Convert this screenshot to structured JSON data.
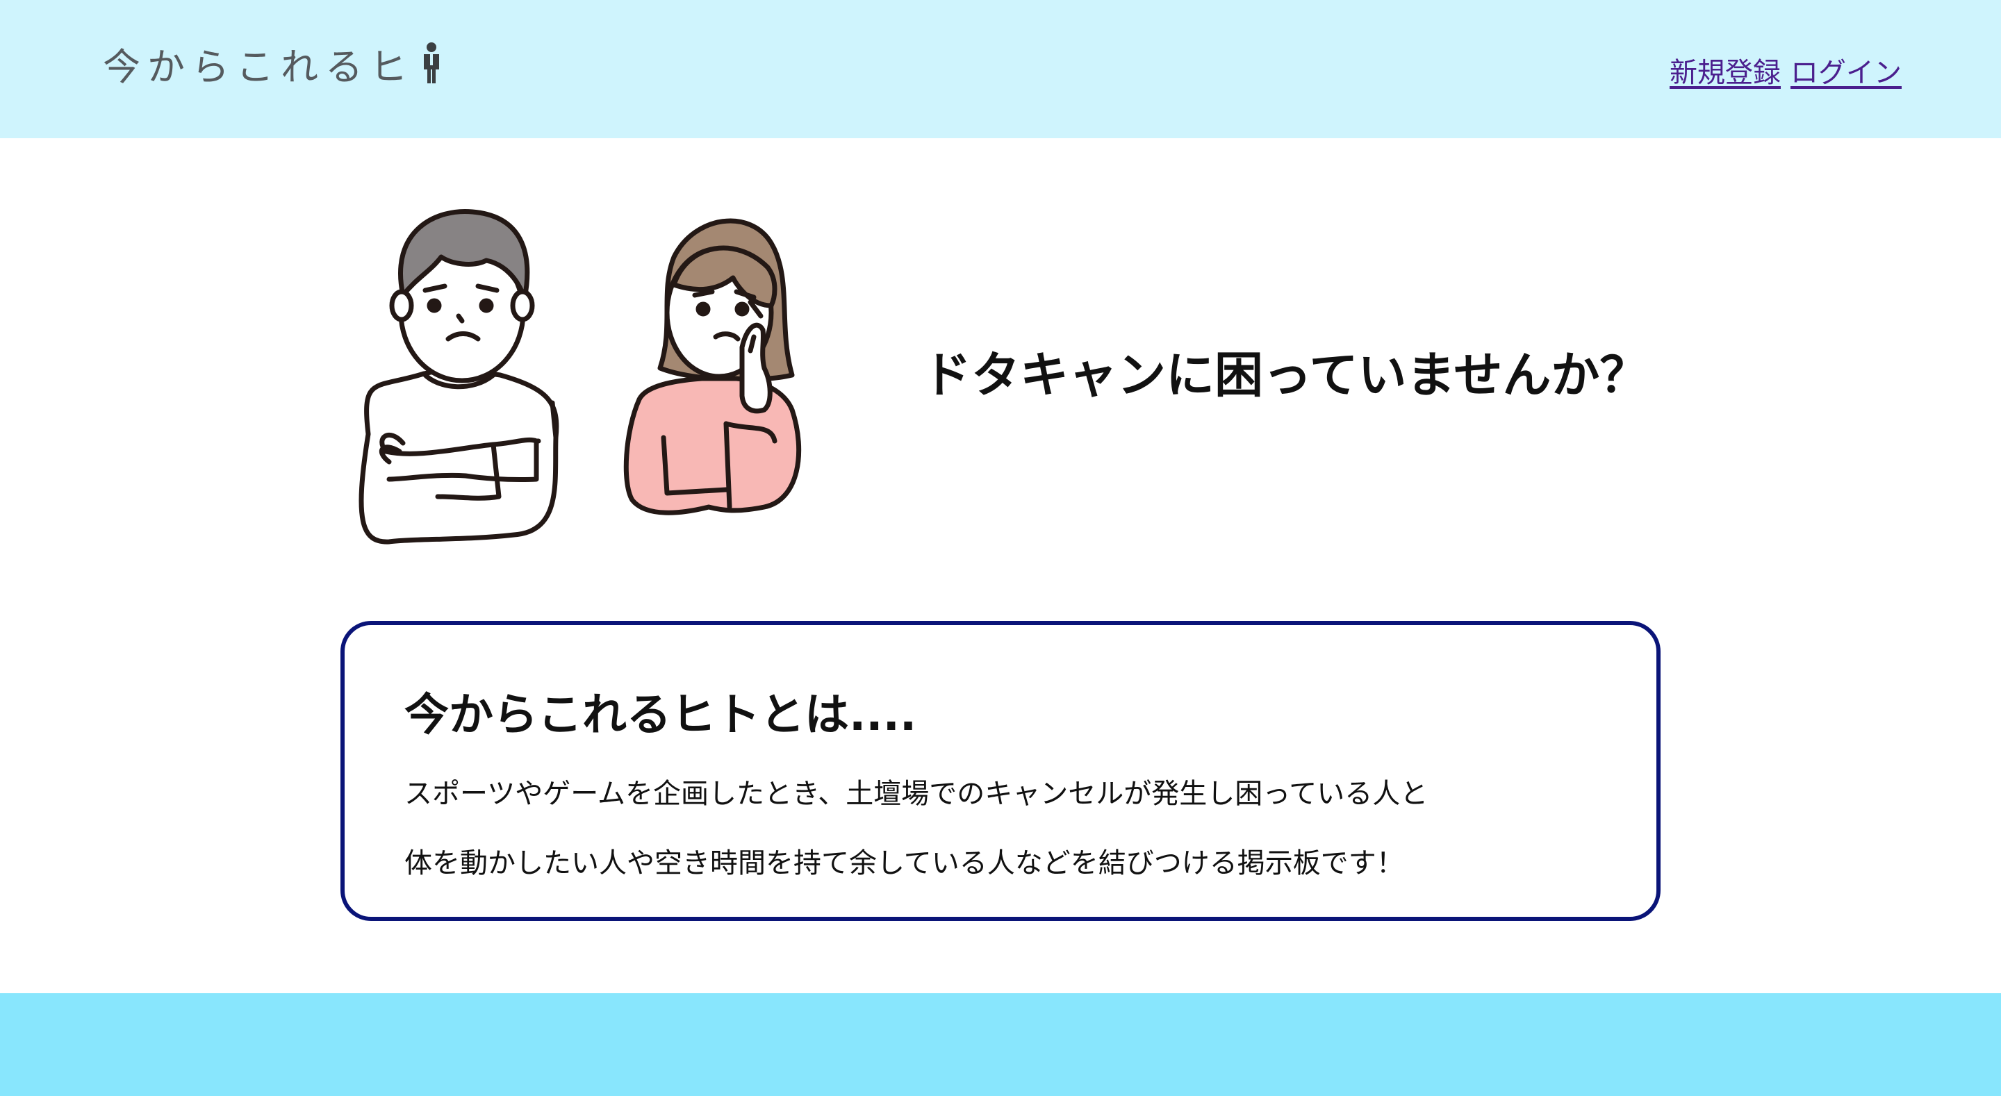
{
  "header": {
    "logo_text": "今からこれるヒ",
    "logo_icon": "person-icon",
    "nav": {
      "signup_label": "新規登録",
      "login_label": "ログイン"
    }
  },
  "hero": {
    "illustration": "two-worried-people",
    "question": "ドタキャンに困っていませんか？"
  },
  "about": {
    "title": "今からこれるヒトとは....",
    "lines": [
      "スポーツやゲームを企画したとき、土壇場でのキャンセルが発生し困っている人と",
      "体を動かしたい人や空き時間を持て余している人などを結びつける掲示板です！"
    ]
  },
  "colors": {
    "header_bg": "#cff4fd",
    "footer_bg": "#88e6fd",
    "box_border": "#0a1478",
    "link": "#4b1f8e"
  }
}
